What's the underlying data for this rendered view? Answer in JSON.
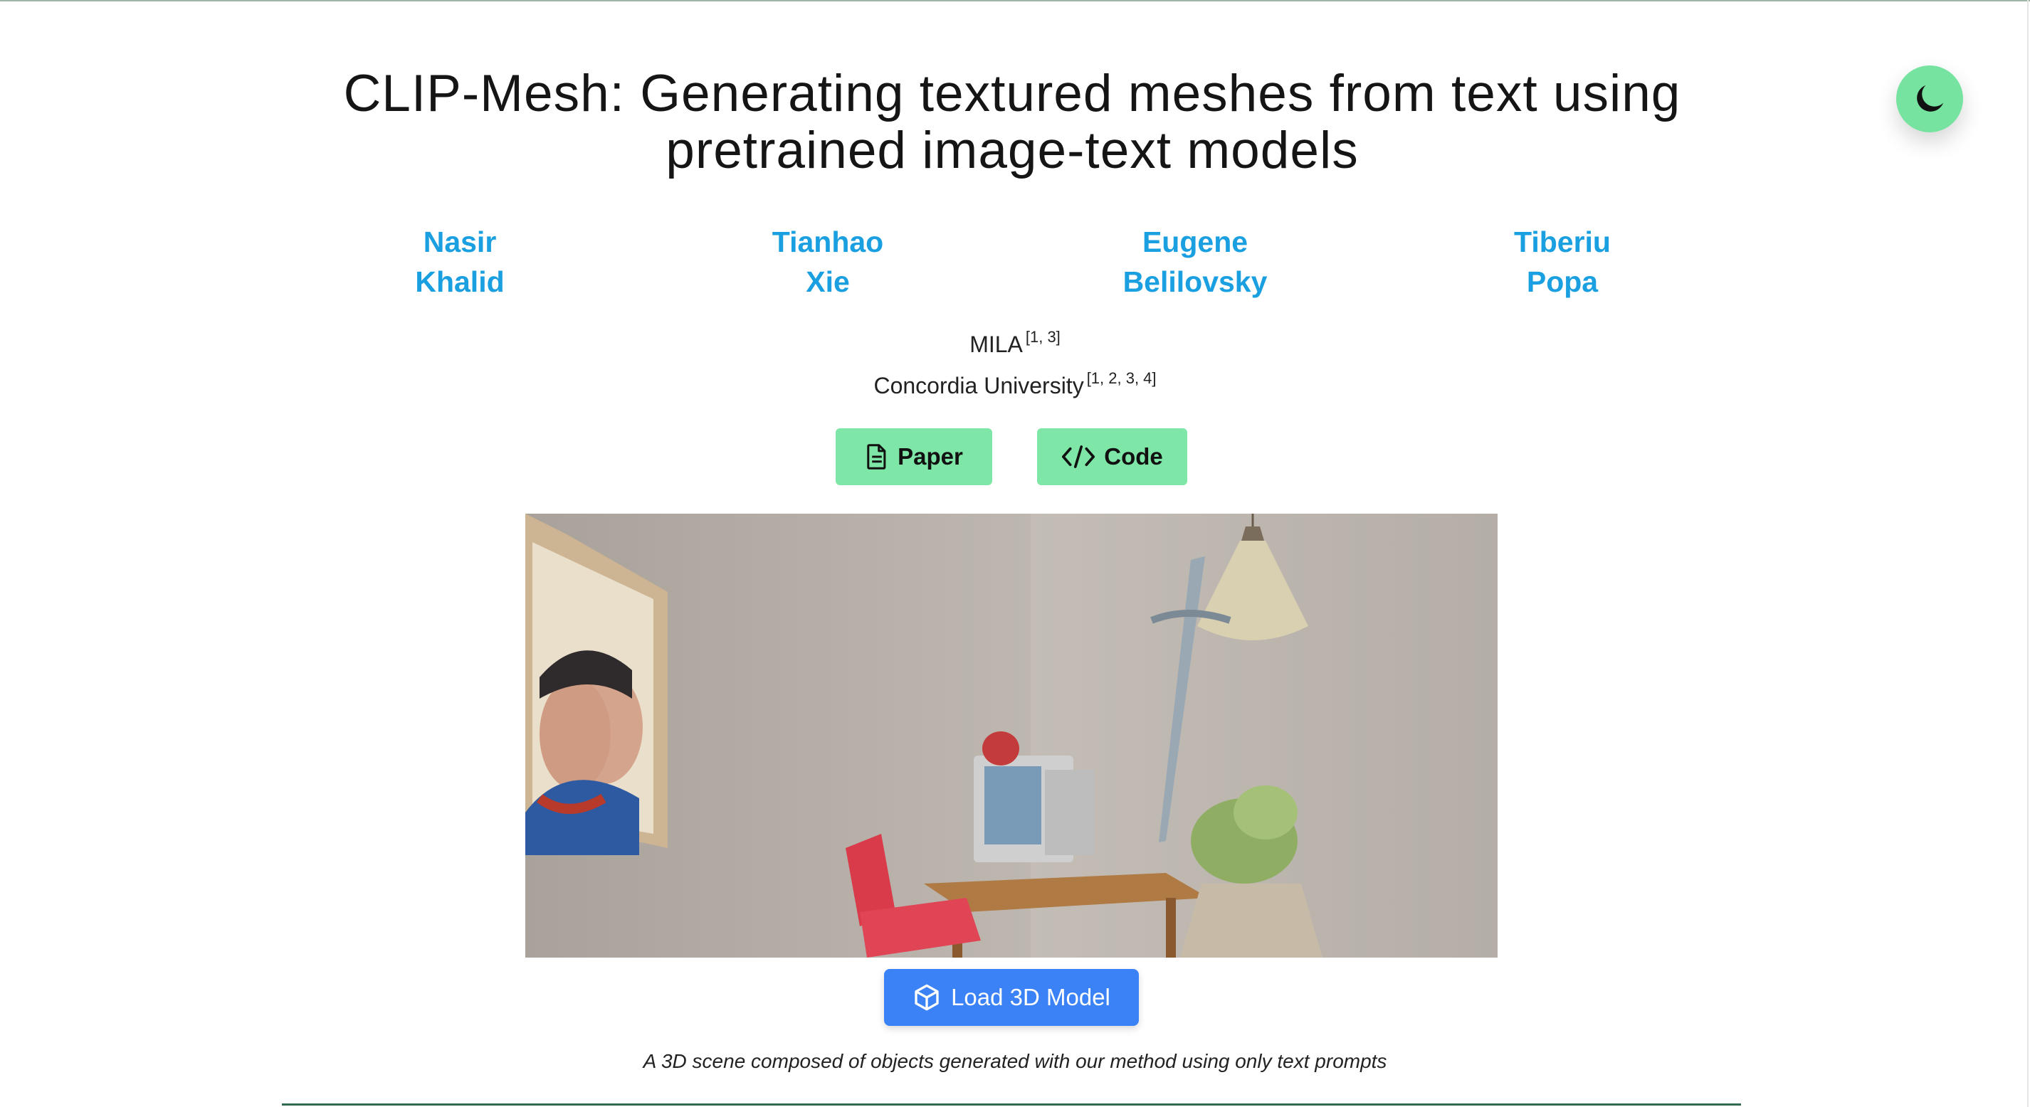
{
  "header": {
    "title_line1": "CLIP-Mesh: Generating textured meshes from text using",
    "title_line2": "pretrained image-text models"
  },
  "authors": [
    {
      "first": "Nasir",
      "last": "Khalid"
    },
    {
      "first": "Tianhao",
      "last": "Xie"
    },
    {
      "first": "Eugene",
      "last": "Belilovsky"
    },
    {
      "first": "Tiberiu",
      "last": "Popa"
    }
  ],
  "affiliations": [
    {
      "name": "MILA",
      "refs": "[1, 3]"
    },
    {
      "name": "Concordia University",
      "refs": "[1, 2, 3, 4]"
    }
  ],
  "links": {
    "paper_label": "Paper",
    "code_label": "Code"
  },
  "viewer": {
    "load_label": "Load 3D Model",
    "caption": "A 3D scene composed of objects generated with our method using only text prompts"
  },
  "colors": {
    "accent_green": "#7ee6a7",
    "author_blue": "#1a9fe0",
    "load_blue": "#3b82f6"
  },
  "icons": {
    "theme_toggle": "moon-icon",
    "paper": "document-icon",
    "code": "code-icon",
    "load": "cube-icon"
  }
}
